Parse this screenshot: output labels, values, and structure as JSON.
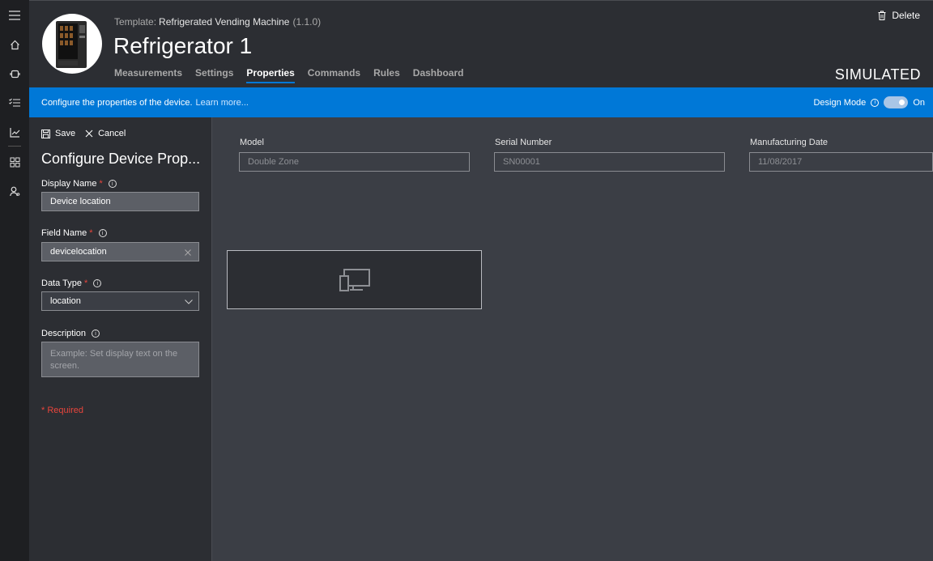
{
  "nav": {
    "icons": [
      "hamburger-menu-icon",
      "home-icon",
      "devices-icon",
      "tasks-icon",
      "analytics-icon",
      "dashboard-grid-icon",
      "user-admin-icon"
    ]
  },
  "header": {
    "template_label": "Template:",
    "template_name": "Refrigerated Vending Machine",
    "template_version": "(1.1.0)",
    "device_name": "Refrigerator 1",
    "delete_label": "Delete",
    "status": "SIMULATED",
    "tabs": [
      {
        "label": "Measurements",
        "active": false
      },
      {
        "label": "Settings",
        "active": false
      },
      {
        "label": "Properties",
        "active": true
      },
      {
        "label": "Commands",
        "active": false
      },
      {
        "label": "Rules",
        "active": false
      },
      {
        "label": "Dashboard",
        "active": false
      }
    ]
  },
  "banner": {
    "text": "Configure the properties of the device.",
    "link": "Learn more...",
    "design_mode_label": "Design Mode",
    "design_mode_state": "On"
  },
  "panel": {
    "save_label": "Save",
    "cancel_label": "Cancel",
    "title": "Configure Device Prop...",
    "display_name": {
      "label": "Display Name",
      "required_mark": "*",
      "value": "Device location"
    },
    "field_name": {
      "label": "Field Name",
      "required_mark": "*",
      "value": "devicelocation"
    },
    "data_type": {
      "label": "Data Type",
      "required_mark": "*",
      "value": "location"
    },
    "description": {
      "label": "Description",
      "placeholder": "Example: Set display text on the screen."
    },
    "required_note": "* Required"
  },
  "properties": [
    {
      "label": "Model",
      "value": "Double Zone"
    },
    {
      "label": "Serial Number",
      "value": "SN00001"
    },
    {
      "label": "Manufacturing Date",
      "value": "11/08/2017"
    }
  ],
  "colors": {
    "accent": "#0078d7",
    "required": "#e8453c"
  }
}
